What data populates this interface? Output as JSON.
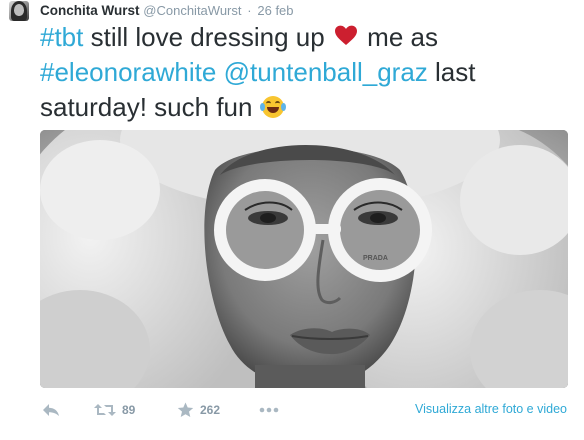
{
  "tweet": {
    "author_name": "Conchita Wurst",
    "author_handle": "@ConchitaWurst",
    "separator": "·",
    "timestamp": "26 feb",
    "text": {
      "hashtag_tbt": "#tbt",
      "part1": " still love dressing up ",
      "part2": " me as",
      "hashtag_eleonora": "#eleonorawhite",
      "mention": "@tuntenball_graz",
      "part3": " last",
      "part4": "saturday! such fun "
    },
    "media_watermark": "PRADA",
    "actions": {
      "retweet_count": "89",
      "favorite_count": "262",
      "view_media_label": "Visualizza altre foto e video"
    },
    "colors": {
      "link": "#2fa9d6",
      "text": "#292f33",
      "muted": "#8899a6",
      "heart": "#cc1f2f"
    },
    "icons": [
      "reply-icon",
      "retweet-icon",
      "favorite-star-icon",
      "more-dots-icon",
      "heart-emoji-icon",
      "tears-of-joy-emoji-icon"
    ]
  }
}
